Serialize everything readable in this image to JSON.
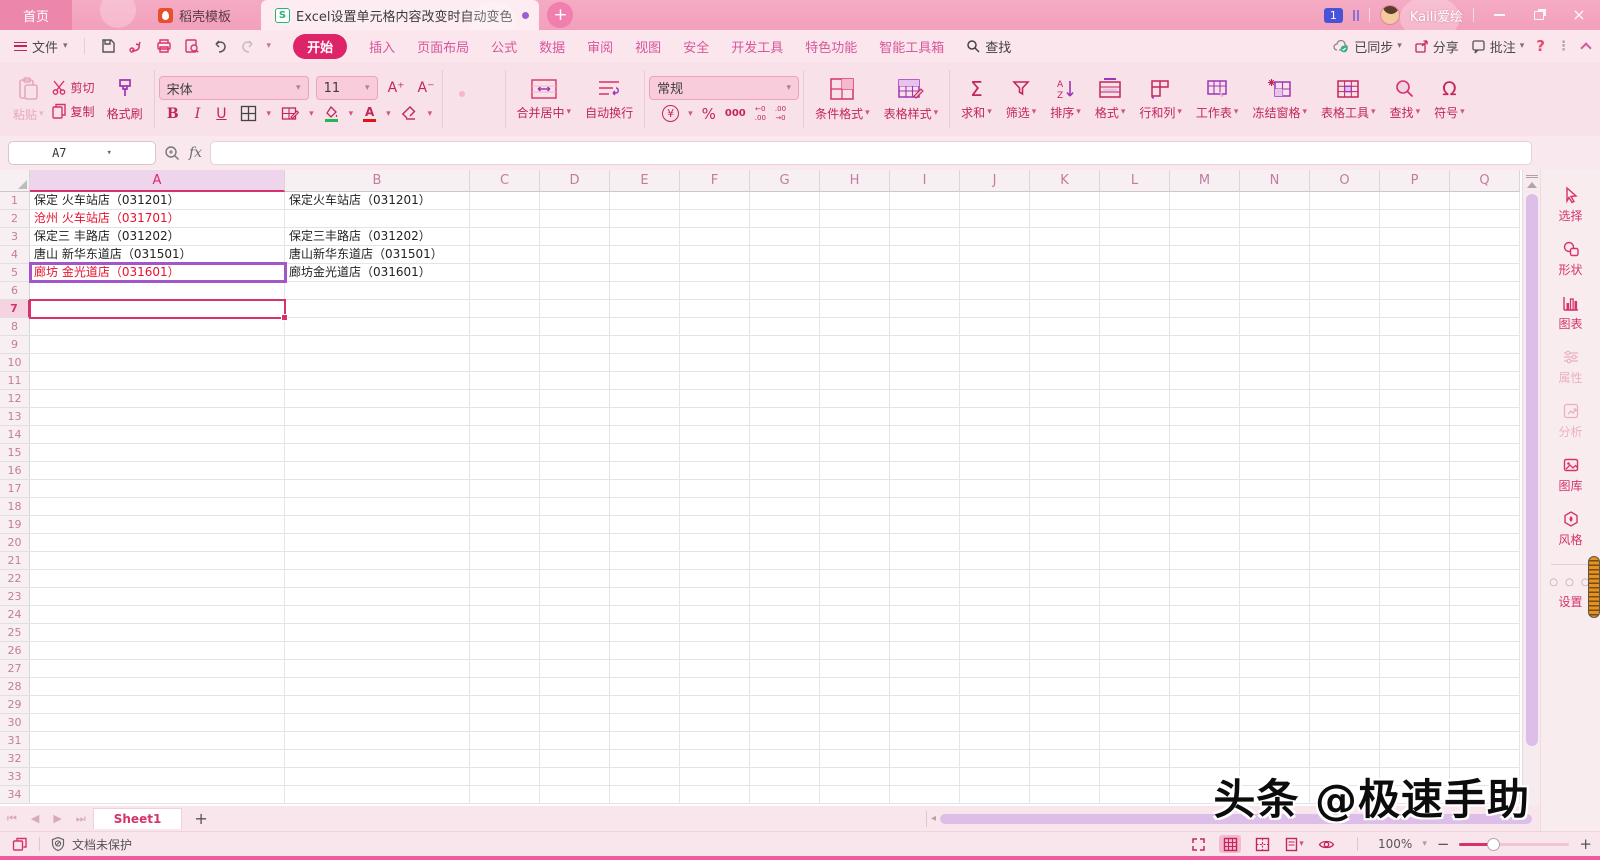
{
  "colors": {
    "accent": "#de2368",
    "selection_border": "#d6336c",
    "highlight_border": "#a456c9",
    "red_text": "#e8112d",
    "titlebar_pink": "#f3a5c0",
    "ribbon_ink": "#c2255c"
  },
  "titlebar": {
    "home_tab": "首页",
    "docer_tab": "稻壳模板",
    "doc_tab": "Excel设置单元格内容改变时自动变色",
    "doc_icon_letter": "S",
    "badge": "1",
    "username": "Kaili爱绘"
  },
  "menubar": {
    "file": "文件",
    "tabs": [
      "开始",
      "插入",
      "页面布局",
      "公式",
      "数据",
      "审阅",
      "视图",
      "安全",
      "开发工具",
      "特色功能",
      "智能工具箱"
    ],
    "active_tab": "开始",
    "search": "查找",
    "synced": "已同步",
    "share": "分享",
    "comment": "批注",
    "help": "?",
    "more": "⋮"
  },
  "ribbon": {
    "paste": "粘贴",
    "cut": "剪切",
    "copy": "复制",
    "painter": "格式刷",
    "font_name": "宋体",
    "font_size": "11",
    "font_up": "A⁺",
    "font_down": "A⁻",
    "bold": "B",
    "italic": "I",
    "underline": "U",
    "merge": "合并居中",
    "wrap": "自动换行",
    "num_format": "常规",
    "symbols": {
      "currency": "¥",
      "percent": "%",
      "thousands": "000",
      "dec_left_top": "←0",
      "dec_left_bottom": ".00",
      "dec_right_top": ".00",
      "dec_right_bottom": "→0"
    },
    "conditional": "条件格式",
    "table_style": "表格样式",
    "big_buttons": [
      {
        "label": "求和",
        "icon": "sum-icon",
        "glyph": "Σ"
      },
      {
        "label": "筛选",
        "icon": "filter-icon"
      },
      {
        "label": "排序",
        "icon": "sort-icon"
      },
      {
        "label": "格式",
        "icon": "format-icon"
      },
      {
        "label": "行和列",
        "icon": "rows-cols-icon"
      },
      {
        "label": "工作表",
        "icon": "worksheet-icon"
      },
      {
        "label": "冻结窗格",
        "icon": "freeze-icon"
      },
      {
        "label": "表格工具",
        "icon": "table-tools-icon"
      },
      {
        "label": "查找",
        "icon": "find-icon"
      },
      {
        "label": "符号",
        "icon": "symbol-icon",
        "glyph": "Ω"
      }
    ]
  },
  "formula_bar": {
    "name_box": "A7",
    "fx": "fx",
    "formula": ""
  },
  "sheet": {
    "columns": [
      "A",
      "B",
      "C",
      "D",
      "E",
      "F",
      "G",
      "H",
      "I",
      "J",
      "K",
      "L",
      "M",
      "N",
      "O",
      "P",
      "Q"
    ],
    "row_count": 34,
    "selected_column": "A",
    "selected_row": 7,
    "active_cell": "A7",
    "highlighted_cell": "A5",
    "cells": [
      {
        "r": 1,
        "c": "A",
        "text": "保定 火车站店（031201）",
        "color": "black"
      },
      {
        "r": 1,
        "c": "B",
        "text": "保定火车站店（031201）",
        "color": "black"
      },
      {
        "r": 2,
        "c": "A",
        "text": "沧州 火车站店（031701）",
        "color": "red"
      },
      {
        "r": 3,
        "c": "A",
        "text": "保定三 丰路店（031202）",
        "color": "black"
      },
      {
        "r": 3,
        "c": "B",
        "text": "保定三丰路店（031202）",
        "color": "black"
      },
      {
        "r": 4,
        "c": "A",
        "text": "唐山 新华东道店（031501）",
        "color": "black"
      },
      {
        "r": 4,
        "c": "B",
        "text": "唐山新华东道店（031501）",
        "color": "black"
      },
      {
        "r": 5,
        "c": "A",
        "text": "廊坊 金光道店（031601）",
        "color": "red"
      },
      {
        "r": 5,
        "c": "B",
        "text": "廊坊金光道店（031601）",
        "color": "black"
      }
    ]
  },
  "sidebar": {
    "items": [
      {
        "label": "选择",
        "icon": "cursor-icon",
        "disabled": false
      },
      {
        "label": "形状",
        "icon": "shapes-icon",
        "disabled": false
      },
      {
        "label": "图表",
        "icon": "chart-icon",
        "disabled": false
      },
      {
        "label": "属性",
        "icon": "properties-icon",
        "disabled": true
      },
      {
        "label": "分析",
        "icon": "analysis-icon",
        "disabled": true
      },
      {
        "label": "图库",
        "icon": "gallery-icon",
        "disabled": false
      },
      {
        "label": "风格",
        "icon": "style-icon",
        "disabled": false
      },
      {
        "label": "设置",
        "icon": "settings-icon",
        "disabled": false
      }
    ]
  },
  "tabbar": {
    "sheet_name": "Sheet1"
  },
  "statusbar": {
    "protection": "文档未保护",
    "zoom": "100%"
  },
  "watermark": {
    "text": "头条 @极速手助"
  }
}
